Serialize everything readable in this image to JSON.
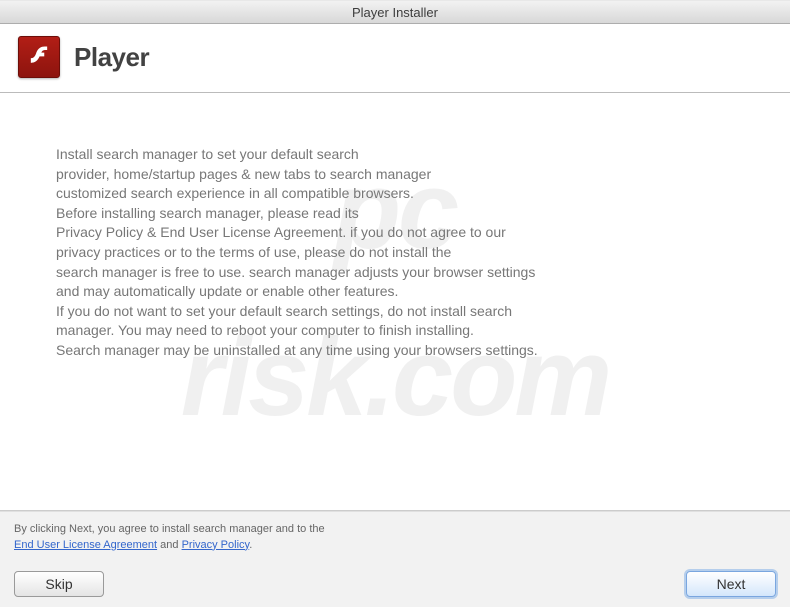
{
  "window": {
    "title": "Player Installer"
  },
  "header": {
    "title": "Player",
    "icon_name": "flash-logo-icon"
  },
  "body": {
    "l1": "Install search manager to set your default search",
    "l2": "provider, home/startup pages & new tabs to search manager",
    "l3": "customized search experience in all compatible browsers.",
    "l4": "Before installing search manager, please read its",
    "l5": "Privacy Policy & End User License Agreement. if you do not agree to our",
    "l6": "privacy practices or to the terms of use, please do not install the",
    "l7": "search manager is free to use. search manager adjusts your browser settings",
    "l8": "and may automatically update or enable other features.",
    "l9": "If you do not want to set your default search settings, do not install search",
    "l10": "manager. You may need to reboot your computer to finish installing.",
    "l11": "Search manager may be uninstalled at any time using your browsers settings."
  },
  "agreement": {
    "prefix": "By clicking Next, you agree to install search manager and to the",
    "eula": "End User License Agreement",
    "and": " and ",
    "privacy": "Privacy Policy",
    "suffix": "."
  },
  "buttons": {
    "skip": "Skip",
    "next": "Next"
  },
  "watermark": {
    "top": "pc",
    "bottom": "risk.com"
  }
}
